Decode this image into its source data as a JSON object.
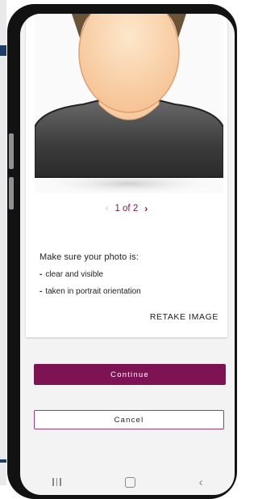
{
  "pager": {
    "prev_icon": "‹",
    "label": "1 of 2",
    "next_icon": "›"
  },
  "instructions": {
    "title": "Make sure your photo is:",
    "items": [
      {
        "dash": "-",
        "text": "clear and visible"
      },
      {
        "dash": "-",
        "text": "taken in portrait orientation"
      }
    ]
  },
  "actions": {
    "retake_label": "RETAKE IMAGE",
    "continue_label": "Continue",
    "cancel_label": "Cancel"
  },
  "colors": {
    "brand": "#7e1353",
    "background": "#f3f3f3",
    "card": "#ffffff"
  },
  "icons": {
    "photo": "avatar-placeholder-icon",
    "nav_recents": "recents-icon",
    "nav_home": "home-icon",
    "nav_back": "back-icon"
  }
}
